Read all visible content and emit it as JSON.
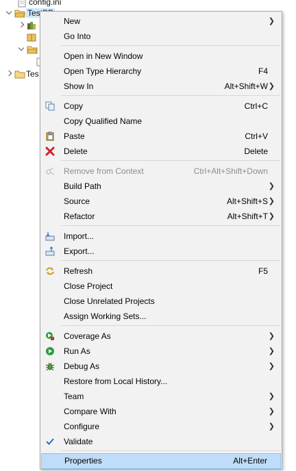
{
  "tree": {
    "rows": [
      {
        "label": "config.ini"
      },
      {
        "label": "TestPP"
      },
      {
        "label": ""
      },
      {
        "label": ""
      },
      {
        "label": ""
      },
      {
        "label": "Tes"
      }
    ]
  },
  "menu": {
    "items": [
      {
        "label": "New",
        "shortcut": "",
        "submenu": true,
        "icon": ""
      },
      {
        "label": "Go Into",
        "shortcut": "",
        "submenu": false,
        "icon": ""
      },
      {
        "label": "Open in New Window",
        "shortcut": "",
        "submenu": false,
        "icon": ""
      },
      {
        "label": "Open Type Hierarchy",
        "shortcut": "F4",
        "submenu": false,
        "icon": ""
      },
      {
        "label": "Show In",
        "shortcut": "Alt+Shift+W",
        "submenu": true,
        "icon": ""
      },
      {
        "label": "Copy",
        "shortcut": "Ctrl+C",
        "submenu": false,
        "icon": "copy-icon"
      },
      {
        "label": "Copy Qualified Name",
        "shortcut": "",
        "submenu": false,
        "icon": ""
      },
      {
        "label": "Paste",
        "shortcut": "Ctrl+V",
        "submenu": false,
        "icon": "paste-icon"
      },
      {
        "label": "Delete",
        "shortcut": "Delete",
        "submenu": false,
        "icon": "delete-icon"
      },
      {
        "label": "Remove from Context",
        "shortcut": "Ctrl+Alt+Shift+Down",
        "submenu": false,
        "icon": "remove-context-icon",
        "disabled": true
      },
      {
        "label": "Build Path",
        "shortcut": "",
        "submenu": true,
        "icon": ""
      },
      {
        "label": "Source",
        "shortcut": "Alt+Shift+S",
        "submenu": true,
        "icon": ""
      },
      {
        "label": "Refactor",
        "shortcut": "Alt+Shift+T",
        "submenu": true,
        "icon": ""
      },
      {
        "label": "Import...",
        "shortcut": "",
        "submenu": false,
        "icon": "import-icon"
      },
      {
        "label": "Export...",
        "shortcut": "",
        "submenu": false,
        "icon": "export-icon"
      },
      {
        "label": "Refresh",
        "shortcut": "F5",
        "submenu": false,
        "icon": "refresh-icon"
      },
      {
        "label": "Close Project",
        "shortcut": "",
        "submenu": false,
        "icon": ""
      },
      {
        "label": "Close Unrelated Projects",
        "shortcut": "",
        "submenu": false,
        "icon": ""
      },
      {
        "label": "Assign Working Sets...",
        "shortcut": "",
        "submenu": false,
        "icon": ""
      },
      {
        "label": "Coverage As",
        "shortcut": "",
        "submenu": true,
        "icon": "coverage-icon"
      },
      {
        "label": "Run As",
        "shortcut": "",
        "submenu": true,
        "icon": "run-icon"
      },
      {
        "label": "Debug As",
        "shortcut": "",
        "submenu": true,
        "icon": "debug-icon"
      },
      {
        "label": "Restore from Local History...",
        "shortcut": "",
        "submenu": false,
        "icon": ""
      },
      {
        "label": "Team",
        "shortcut": "",
        "submenu": true,
        "icon": ""
      },
      {
        "label": "Compare With",
        "shortcut": "",
        "submenu": true,
        "icon": ""
      },
      {
        "label": "Configure",
        "shortcut": "",
        "submenu": true,
        "icon": ""
      },
      {
        "label": "Validate",
        "shortcut": "",
        "submenu": false,
        "icon": "check-icon"
      },
      {
        "label": "Properties",
        "shortcut": "Alt+Enter",
        "submenu": false,
        "icon": "",
        "highlighted": true
      }
    ]
  },
  "colors": {
    "menu_bg": "#f2f2f2",
    "highlight": "#bfdcf8",
    "disabled_text": "#8d8d8d"
  }
}
